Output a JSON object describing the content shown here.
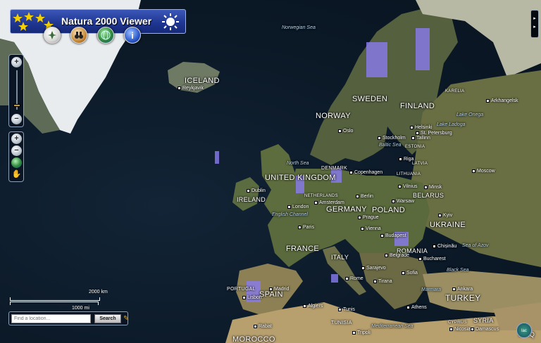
{
  "app": {
    "title": "Natura 2000 Viewer",
    "colors": {
      "banner": "#1e3590",
      "accent_yellow": "#f5d000",
      "site_markers": "#8a7cf0"
    }
  },
  "toolbar": {
    "buttons": [
      {
        "icon": "layers-icon"
      },
      {
        "icon": "binoculars-icon"
      },
      {
        "icon": "globe-icon"
      },
      {
        "icon": "info-icon",
        "label": "i"
      }
    ]
  },
  "navigation": {
    "zoom_in_icon": "zoom-in-icon",
    "zoom_out_icon": "zoom-out-icon",
    "tools": [
      "zoom-in-icon",
      "zoom-out-icon",
      "globe-icon",
      "pan-hand-icon"
    ]
  },
  "panel_toggle": {
    "label": "▸\n▸"
  },
  "scale": {
    "km_label": "2000 km",
    "mi_label": "1000 mi"
  },
  "search": {
    "placeholder": "Find a location...",
    "button_label": "Search"
  },
  "map": {
    "countries": {
      "iceland": "ICELAND",
      "uk": "UNITED KINGDOM",
      "ireland": "IRELAND",
      "norway": "NORWAY",
      "sweden": "SWEDEN",
      "finland": "FINLAND",
      "denmark": "DENMARK",
      "germany": "GERMANY",
      "poland": "POLAND",
      "belarus": "BELARUS",
      "ukraine": "UKRAINE",
      "france": "FRANCE",
      "italy": "ITALY",
      "romania": "ROMANIA",
      "spain": "SPAIN",
      "portugal": "PORTUGAL",
      "turkey": "TURKEY",
      "syria": "SYRIA",
      "iraq": "IRAQ",
      "morocco": "MOROCCO",
      "tunisia": "TUNISIA",
      "latvia": "LATVIA",
      "lithuania": "LITHUANIA",
      "estonia": "ESTONIA",
      "netherlands": "NETHERLANDS",
      "karelia": "KARELIA",
      "cyprus": "CYPRUS"
    },
    "seas": {
      "norwegian": "Norwegian Sea",
      "north": "North Sea",
      "baltic": "Baltic Sea",
      "english_channel": "English Channel",
      "black": "Black Sea",
      "mediterranean": "Mediterranean Sea",
      "azov": "Sea of Azov",
      "ladoga": "Lake Ladoga",
      "onega": "Lake Onega",
      "marmara": "Marmara"
    },
    "cities": {
      "reykjavik": "Reykjavik",
      "oslo": "Oslo",
      "stockholm": "Stockholm",
      "helsinki": "Helsinki",
      "tallinn": "Tallinn",
      "riga": "Riga",
      "copenhagen": "Copenhagen",
      "vilnius": "Vilnius",
      "minsk": "Minsk",
      "moscow": "Moscow",
      "warsaw": "Warsaw",
      "berlin": "Berlin",
      "amsterdam": "Amsterdam",
      "london": "London",
      "dublin": "Dublin",
      "paris": "Paris",
      "prague": "Prague",
      "vienna": "Vienna",
      "budapest": "Budapest",
      "kyiv": "Kyiv",
      "chisinau": "Chișinău",
      "bucharest": "Bucharest",
      "sofia": "Sofia",
      "belgrade": "Belgrade",
      "sarajevo": "Sarajevo",
      "tirana": "Tirana",
      "rome": "Rome",
      "athens": "Athens",
      "ankara": "Ankara",
      "madrid": "Madrid",
      "lisbon": "Lisbon",
      "algiers": "Algiers",
      "tunis": "Tunis",
      "tripoli": "Tripoli",
      "rabat": "Rabat",
      "damascus": "Damascus",
      "archangelsk": "Arkhangelsk",
      "st_petersburg": "St. Petersburg",
      "nicosia": "Nicosia"
    }
  },
  "corner_logo": {
    "label": "lac"
  }
}
